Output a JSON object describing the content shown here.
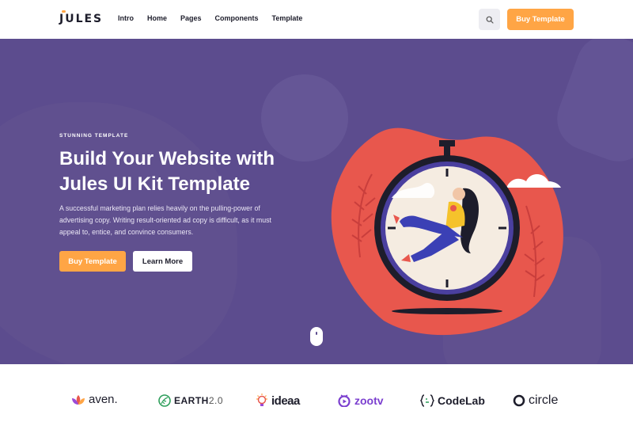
{
  "header": {
    "logo_text": "JULES",
    "nav": [
      "Intro",
      "Home",
      "Pages",
      "Components",
      "Template"
    ],
    "buy_label": "Buy Template"
  },
  "hero": {
    "eyebrow": "STUNNING TEMPLATE",
    "headline": "Build Your Website with Jules UI Kit Template",
    "description": "A successful marketing plan relies heavily on the pulling-power of advertising copy. Writing result-oriented ad copy is difficult, as it must appeal to, entice, and convince consumers.",
    "buy_label": "Buy Template",
    "learn_label": "Learn More"
  },
  "brands": [
    {
      "name": "aven.",
      "icon": "lotus-icon"
    },
    {
      "name": "EARTH",
      "suffix": "2.0",
      "icon": "leaf-globe-icon"
    },
    {
      "name": "ideaa",
      "icon": "bulb-icon"
    },
    {
      "name": "zootv",
      "icon": "tv-icon"
    },
    {
      "name": "CodeLab",
      "icon": "braces-icon"
    },
    {
      "name": "circle",
      "icon": "ring-icon"
    }
  ],
  "colors": {
    "accent": "#ffa545",
    "hero_bg": "#5c4c8e",
    "illustration_red": "#e8574d"
  }
}
